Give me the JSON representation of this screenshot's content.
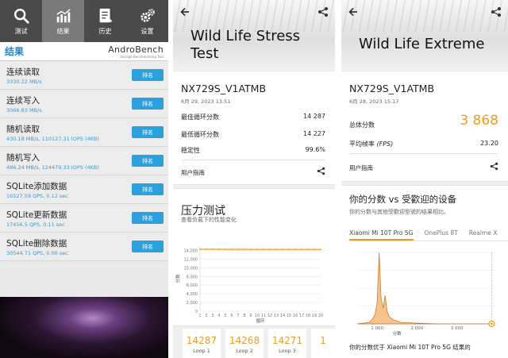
{
  "androbench": {
    "nav": [
      {
        "label": "测试",
        "icon": "search-icon"
      },
      {
        "label": "结果",
        "icon": "chart-icon"
      },
      {
        "label": "历史",
        "icon": "document-icon"
      },
      {
        "label": "设置",
        "icon": "gear-icon"
      }
    ],
    "results_title": "结果",
    "logo_name": "AndroBench",
    "logo_sub": "Storage Benchmarking Tool",
    "rank_label": "排名",
    "rows": [
      {
        "title": "连续读取",
        "value": "3330.22 MB/s"
      },
      {
        "title": "连续写入",
        "value": "3066.83 MB/s"
      },
      {
        "title": "随机读取",
        "value": "430.18 MB/s, 110127.31 IOPS (4KB)"
      },
      {
        "title": "随机写入",
        "value": "486.24 MB/s, 124479.33 IOPS (4KB)"
      },
      {
        "title": "SQLite添加数据",
        "value": "16527.59 QPS, 0.12 sec"
      },
      {
        "title": "SQLite更新数据",
        "value": "17456.5 QPS, 0.11 sec"
      },
      {
        "title": "SQLite删除数据",
        "value": "30544.71 QPS, 0.06 sec"
      }
    ]
  },
  "stress": {
    "title_line1": "Wild Life Stress",
    "title_line2": "Test",
    "device": "NX729S_V1ATMB",
    "date": "6月 29, 2023 13:51",
    "best_label": "最佳循环分数",
    "best_value": "14 287",
    "worst_label": "最低循环分数",
    "worst_value": "14 227",
    "stability_label": "稳定性",
    "stability_value": "99.6%",
    "guide_label": "用户指南",
    "section_title": "压力测试",
    "section_sub": "查看负载下的性能变化",
    "loops": [
      {
        "score": "14287",
        "label": "Loop 1"
      },
      {
        "score": "14268",
        "label": "Loop 2"
      },
      {
        "score": "14271",
        "label": "Loop 3"
      },
      {
        "score": "1",
        "label": ""
      }
    ]
  },
  "extreme": {
    "title": "Wild Life Extreme",
    "device": "NX729S_V1ATMB",
    "date": "6月 28, 2023 15:17",
    "score_label": "总体分数",
    "score_value": "3 868",
    "fps_label": "平均帧率",
    "fps_unit": "(FPS)",
    "fps_value": "23.20",
    "guide_label": "用户指南",
    "compare_title": "你的分数 vs 受歡迎的设备",
    "compare_sub": "你的分数与其他受歡迎型號的结果相比。",
    "tabs": [
      "Xiaomi Mi 10T Pro 5G",
      "OnePlus 8T",
      "Realme X"
    ],
    "footer": "你的分数优于 Xiaomi Mi 10T Pro 5G 结果的"
  },
  "chart_data": [
    {
      "type": "line",
      "title": "",
      "xlabel": "循环",
      "ylabel": "分数",
      "x": [
        1,
        2,
        3,
        4,
        5,
        6,
        7,
        8,
        9,
        10,
        11,
        12,
        13,
        14,
        15,
        16,
        17,
        18,
        19,
        20
      ],
      "series": [
        {
          "values": [
            14287,
            14268,
            14271,
            14260,
            14250,
            14255,
            14240,
            14245,
            14250,
            14235,
            14240,
            14238,
            14245,
            14230,
            14240,
            14235,
            14230,
            14240,
            14232,
            14227
          ]
        }
      ],
      "xticks": [
        1,
        2,
        3,
        4,
        5,
        6,
        7,
        8,
        9,
        10,
        11,
        12,
        13,
        14,
        15,
        16,
        17,
        18,
        19,
        20
      ],
      "yticks": [
        "0",
        "2,000",
        "4,000",
        "6,000",
        "8,000",
        "10,000",
        "12,000",
        "14,000"
      ],
      "ylim": [
        0,
        15000
      ],
      "grid": true,
      "color": "#f39a1c"
    },
    {
      "type": "area",
      "title": "",
      "xlabel": "分数",
      "ylabel": "",
      "x": [
        500,
        800,
        900,
        950,
        1000,
        1050,
        1100,
        1150,
        1200,
        1250,
        1300,
        1400,
        1500,
        1600,
        2000,
        2500,
        3000,
        3500,
        3868
      ],
      "values": [
        0,
        2,
        8,
        14,
        30,
        100,
        35,
        22,
        40,
        18,
        10,
        6,
        4,
        2,
        1,
        0,
        0,
        0,
        0
      ],
      "xticks": [
        "1 000",
        "2 000",
        "3 000"
      ],
      "xlim": [
        500,
        4000
      ],
      "marker_value": 3868,
      "color": "#f39a1c"
    }
  ]
}
